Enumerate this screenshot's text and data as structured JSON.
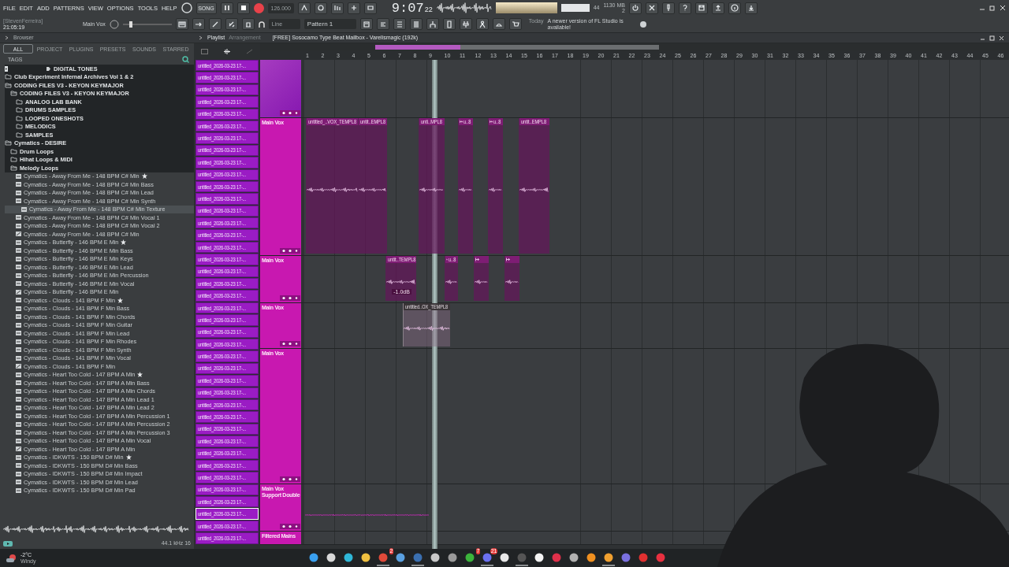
{
  "menu": [
    "FILE",
    "EDIT",
    "ADD",
    "PATTERNS",
    "VIEW",
    "OPTIONS",
    "TOOLS",
    "HELP"
  ],
  "hint": "[StevenFerreira]",
  "clock": "21:05:19",
  "channel": "Main Vox",
  "transport": {
    "mode": "SONG",
    "record_armed": true,
    "tempo": "126.000"
  },
  "song_time": {
    "main": "9:07",
    "sub": "22"
  },
  "meters": {
    "cpu": "44",
    "memory": "1130 MB",
    "polyphony": "2"
  },
  "snap": "Line",
  "pattern": "Pattern 1",
  "news": {
    "date": "Today",
    "text": "A newer version of FL Studio is available!"
  },
  "browser": {
    "title": "Browser",
    "tabs": [
      {
        "label": "ALL",
        "selected": true
      },
      {
        "label": "PROJECT",
        "selected": false
      },
      {
        "label": "PLUGINS",
        "selected": false
      },
      {
        "label": "PRESETS",
        "selected": false
      },
      {
        "label": "SOUNDS",
        "selected": false
      },
      {
        "label": "STARRED",
        "selected": false
      }
    ],
    "tags_label": "TAGS",
    "tree": [
      {
        "kind": "tag",
        "label": "DIGITAL TONES"
      },
      {
        "kind": "folder",
        "label": "Club Experiment Infernal Archives Vol 1 & 2",
        "expanded": false
      },
      {
        "kind": "folder",
        "label": "CODING FILES V3 - KEYON KEYMAJOR",
        "expanded": true,
        "children": [
          {
            "kind": "folder",
            "label": "CODING FILES V3 - KEYON KEYMAJOR",
            "expanded": true,
            "children": [
              {
                "kind": "folder",
                "label": "ANALOG LAB BANK",
                "expanded": false
              },
              {
                "kind": "folder",
                "label": "DRUMS SAMPLES",
                "expanded": false
              },
              {
                "kind": "folder",
                "label": "LOOPED ONESHOTS",
                "expanded": false
              },
              {
                "kind": "folder",
                "label": "MELODICS",
                "expanded": false
              },
              {
                "kind": "folder",
                "label": "SAMPLES",
                "expanded": false
              }
            ]
          }
        ]
      },
      {
        "kind": "folder",
        "label": "Cymatics - DESIRE",
        "expanded": true,
        "children": [
          {
            "kind": "folder",
            "label": "Drum Loops",
            "expanded": false
          },
          {
            "kind": "folder",
            "label": "Hihat Loops & MIDI",
            "expanded": false
          },
          {
            "kind": "folder",
            "label": "Melody Loops",
            "expanded": true,
            "children": [
              {
                "kind": "audio",
                "label": "Cymatics - Away From Me - 148 BPM C# Min",
                "starred": true,
                "selected": false
              },
              {
                "kind": "audio",
                "label": "Cymatics - Away From Me - 148 BPM C# Min Bass",
                "starred": false,
                "selected": false
              },
              {
                "kind": "audio",
                "label": "Cymatics - Away From Me - 148 BPM C# Min Lead",
                "starred": false,
                "selected": false
              },
              {
                "kind": "audio",
                "label": "Cymatics - Away From Me - 148 BPM C# Min Synth",
                "starred": false,
                "selected": false
              },
              {
                "kind": "audio",
                "label": "Cymatics - Away From Me - 148 BPM C# Min Texture",
                "starred": false,
                "selected": true
              },
              {
                "kind": "audio",
                "label": "Cymatics - Away From Me - 148 BPM C# Min Vocal 1",
                "starred": false,
                "selected": false
              },
              {
                "kind": "audio",
                "label": "Cymatics - Away From Me - 148 BPM C# Min Vocal 2",
                "starred": false,
                "selected": false
              },
              {
                "kind": "midi",
                "label": "Cymatics - Away From Me - 148 BPM C# Min",
                "starred": false,
                "selected": false
              },
              {
                "kind": "audio",
                "label": "Cymatics - Butterfly - 146 BPM E Min",
                "starred": true,
                "selected": false
              },
              {
                "kind": "audio",
                "label": "Cymatics - Butterfly - 146 BPM E Min Bass",
                "starred": false,
                "selected": false
              },
              {
                "kind": "audio",
                "label": "Cymatics - Butterfly - 146 BPM E Min Keys",
                "starred": false,
                "selected": false
              },
              {
                "kind": "audio",
                "label": "Cymatics - Butterfly - 146 BPM E Min Lead",
                "starred": false,
                "selected": false
              },
              {
                "kind": "audio",
                "label": "Cymatics - Butterfly - 146 BPM E Min Percussion",
                "starred": false,
                "selected": false
              },
              {
                "kind": "audio",
                "label": "Cymatics - Butterfly - 146 BPM E Min Vocal",
                "starred": false,
                "selected": false
              },
              {
                "kind": "midi",
                "label": "Cymatics - Butterfly - 146 BPM E Min",
                "starred": false,
                "selected": false
              },
              {
                "kind": "audio",
                "label": "Cymatics - Clouds - 141 BPM F Min",
                "starred": true,
                "selected": false
              },
              {
                "kind": "audio",
                "label": "Cymatics - Clouds - 141 BPM F Min Bass",
                "starred": false,
                "selected": false
              },
              {
                "kind": "audio",
                "label": "Cymatics - Clouds - 141 BPM F Min Chords",
                "starred": false,
                "selected": false
              },
              {
                "kind": "audio",
                "label": "Cymatics - Clouds - 141 BPM F Min Guitar",
                "starred": false,
                "selected": false
              },
              {
                "kind": "audio",
                "label": "Cymatics - Clouds - 141 BPM F Min Lead",
                "starred": false,
                "selected": false
              },
              {
                "kind": "audio",
                "label": "Cymatics - Clouds - 141 BPM F Min Rhodes",
                "starred": false,
                "selected": false
              },
              {
                "kind": "audio",
                "label": "Cymatics - Clouds - 141 BPM F Min Synth",
                "starred": false,
                "selected": false
              },
              {
                "kind": "audio",
                "label": "Cymatics - Clouds - 141 BPM F Min Vocal",
                "starred": false,
                "selected": false
              },
              {
                "kind": "midi",
                "label": "Cymatics - Clouds - 141 BPM F Min",
                "starred": false,
                "selected": false
              },
              {
                "kind": "audio",
                "label": "Cymatics - Heart Too Cold - 147 BPM A Min",
                "starred": true,
                "selected": false
              },
              {
                "kind": "audio",
                "label": "Cymatics - Heart Too Cold - 147 BPM A Min Bass",
                "starred": false,
                "selected": false
              },
              {
                "kind": "audio",
                "label": "Cymatics - Heart Too Cold - 147 BPM A Min Chords",
                "starred": false,
                "selected": false
              },
              {
                "kind": "audio",
                "label": "Cymatics - Heart Too Cold - 147 BPM A Min Lead 1",
                "starred": false,
                "selected": false
              },
              {
                "kind": "audio",
                "label": "Cymatics - Heart Too Cold - 147 BPM A Min Lead 2",
                "starred": false,
                "selected": false
              },
              {
                "kind": "audio",
                "label": "Cymatics - Heart Too Cold - 147 BPM A Min Percussion 1",
                "starred": false,
                "selected": false
              },
              {
                "kind": "audio",
                "label": "Cymatics - Heart Too Cold - 147 BPM A Min Percussion 2",
                "starred": false,
                "selected": false
              },
              {
                "kind": "audio",
                "label": "Cymatics - Heart Too Cold - 147 BPM A Min Percussion 3",
                "starred": false,
                "selected": false
              },
              {
                "kind": "audio",
                "label": "Cymatics - Heart Too Cold - 147 BPM A Min Vocal",
                "starred": false,
                "selected": false
              },
              {
                "kind": "midi",
                "label": "Cymatics - Heart Too Cold - 147 BPM A Min",
                "starred": false,
                "selected": false
              },
              {
                "kind": "audio",
                "label": "Cymatics - IDKWTS - 150 BPM D# Min",
                "starred": true,
                "selected": false
              },
              {
                "kind": "audio",
                "label": "Cymatics - IDKWTS - 150 BPM D# Min Bass",
                "starred": false,
                "selected": false
              },
              {
                "kind": "audio",
                "label": "Cymatics - IDKWTS - 150 BPM D# Min Impact",
                "starred": false,
                "selected": false
              },
              {
                "kind": "audio",
                "label": "Cymatics - IDKWTS - 150 BPM D# Min Lead",
                "starred": false,
                "selected": false
              },
              {
                "kind": "audio",
                "label": "Cymatics - IDKWTS - 150 BPM D# Min Pad",
                "starred": false,
                "selected": false
              }
            ]
          }
        ]
      }
    ],
    "sample_info": "44.1 kHz 16"
  },
  "picker": [
    {
      "label": "untitled_2026-03-23 17-...",
      "selected": false
    },
    {
      "label": "untitled_2026-03-23 17-...",
      "selected": false
    },
    {
      "label": "untitled_2026-03-23 17-...",
      "selected": false
    },
    {
      "label": "untitled_2026-03-23 17-...",
      "selected": false
    },
    {
      "label": "untitled_2026-03-23 17-...",
      "selected": false
    },
    {
      "label": "untitled_2026-03-23 17-...",
      "selected": false
    },
    {
      "label": "untitled_2026-03-23 17-...",
      "selected": false
    },
    {
      "label": "untitled_2026-03-23 17-...",
      "selected": false
    },
    {
      "label": "untitled_2026-03-23 17-...",
      "selected": false
    },
    {
      "label": "untitled_2026-03-23 17-...",
      "selected": false
    },
    {
      "label": "untitled_2026-03-23 17-...",
      "selected": false
    },
    {
      "label": "untitled_2026-03-23 17-...",
      "selected": false
    },
    {
      "label": "untitled_2026-03-23 17-...",
      "selected": false
    },
    {
      "label": "untitled_2026-03-23 17-...",
      "selected": false
    },
    {
      "label": "untitled_2026-03-23 17-...",
      "selected": false
    },
    {
      "label": "untitled_2026-03-23 17-...",
      "selected": false
    },
    {
      "label": "untitled_2026-03-23 17-...",
      "selected": false
    },
    {
      "label": "untitled_2026-03-23 17-...",
      "selected": false
    },
    {
      "label": "untitled_2026-03-23 17-...",
      "selected": false
    },
    {
      "label": "untitled_2026-03-23 17-...",
      "selected": false
    },
    {
      "label": "untitled_2026-03-23 17-...",
      "selected": false
    },
    {
      "label": "untitled_2026-03-23 17-...",
      "selected": false
    },
    {
      "label": "untitled_2026-03-23 17-...",
      "selected": false
    },
    {
      "label": "untitled_2026-03-23 17-...",
      "selected": false
    },
    {
      "label": "untitled_2026-03-23 17-...",
      "selected": false
    },
    {
      "label": "untitled_2026-03-23 17-...",
      "selected": false
    },
    {
      "label": "untitled_2026-03-23 17-...",
      "selected": false
    },
    {
      "label": "untitled_2026-03-23 17-...",
      "selected": false
    },
    {
      "label": "untitled_2026-03-23 17-...",
      "selected": false
    },
    {
      "label": "untitled_2026-03-23 17-...",
      "selected": false
    },
    {
      "label": "untitled_2026-03-23 17-...",
      "selected": false
    },
    {
      "label": "untitled_2026-03-23 17-...",
      "selected": false
    },
    {
      "label": "untitled_2026-03-23 17-...",
      "selected": false
    },
    {
      "label": "untitled_2026-03-23 17-...",
      "selected": false
    },
    {
      "label": "untitled_2026-03-23 17-...",
      "selected": false
    },
    {
      "label": "untitled_2026-03-23 17-...",
      "selected": false
    },
    {
      "label": "untitled_2026-03-23 17-...",
      "selected": false
    },
    {
      "label": "untitled_2026-03-23 17-...",
      "selected": true
    },
    {
      "label": "untitled_2026-03-23 17-...",
      "selected": false
    },
    {
      "label": "untitled_2026-03-23 17-...",
      "selected": false
    }
  ],
  "playlist": {
    "title": "Playlist",
    "view": "Arrangement",
    "project": "[FREE] Sosocamo Type Beat Mailbox - Varelismagic (192k)",
    "bars": [
      "1",
      "2",
      "3",
      "4",
      "5",
      "6",
      "7",
      "8",
      "9",
      "10",
      "11",
      "12",
      "13",
      "14",
      "15",
      "16",
      "17",
      "18",
      "19",
      "20",
      "21",
      "22",
      "23",
      "24",
      "25",
      "26",
      "27",
      "28",
      "29",
      "30",
      "31",
      "32",
      "33",
      "34",
      "35",
      "36",
      "37",
      "38",
      "39",
      "40",
      "41",
      "42",
      "43",
      "44",
      "45",
      "46"
    ],
    "tracks": [
      {
        "highlighted": true
      },
      {
        "name": "Main Vox",
        "highlighted": false,
        "clips": [
          {
            "kind": "block",
            "label": "untitled_..VOX_TEMPL8",
            "muted": false
          },
          {
            "kind": "block",
            "label": "untit..EMPL8",
            "muted": false
          },
          {
            "kind": "block",
            "label": "unti..MPL8",
            "muted": false
          },
          {
            "kind": "block",
            "label": "u..8",
            "muted": false
          },
          {
            "kind": "block",
            "label": "u..8",
            "muted": false
          },
          {
            "kind": "block",
            "label": "untit..EMPL8",
            "muted": false
          }
        ]
      },
      {
        "name": "Main Vox",
        "highlighted": false,
        "clips": [
          {
            "kind": "block",
            "label": "untit..TEMPL8",
            "tip": "-1.0dB",
            "muted": false
          },
          {
            "kind": "block",
            "label": "u..8",
            "muted": false
          },
          {
            "kind": "block",
            "muted": false
          },
          {
            "kind": "block",
            "muted": false
          }
        ]
      },
      {
        "name": "Main Vox",
        "highlighted": false,
        "clips": [
          {
            "kind": "block",
            "label": "untitled..OX_TEMPL8",
            "muted": true
          }
        ]
      },
      {
        "name": "Main Vox",
        "highlighted": false
      },
      {
        "name": "Main Vox Support Double",
        "highlighted": false,
        "clips": [
          {
            "kind": "line"
          }
        ]
      },
      {
        "name": "Filtered Mains",
        "highlighted": false
      }
    ]
  },
  "taskbar": {
    "weather": {
      "temp": "-2°C",
      "condition": "Windy"
    },
    "apps": [
      {
        "color": "#3aa0f0",
        "running": false
      },
      {
        "color": "#d8d8d8",
        "running": false
      },
      {
        "color": "#2fb7d8",
        "running": false
      },
      {
        "color": "#f0c040",
        "running": false
      },
      {
        "color": "#e04a3a",
        "running": true,
        "badge": "2"
      },
      {
        "color": "#5aa0e0",
        "running": false
      },
      {
        "color": "#3a6fb0",
        "running": true
      },
      {
        "color": "#c8c8c8",
        "running": false
      },
      {
        "color": "#9a9a9a",
        "running": false
      },
      {
        "color": "#3cb43c",
        "running": false,
        "badge": "7"
      },
      {
        "color": "#6a70f0",
        "running": true,
        "badge": "21"
      },
      {
        "color": "#e8e8e8",
        "running": false
      },
      {
        "color": "#555555",
        "running": true
      },
      {
        "color": "#f4f4f4",
        "running": false
      },
      {
        "color": "#e0304a",
        "running": false
      },
      {
        "color": "#b0b0b0",
        "running": false
      },
      {
        "color": "#f09020",
        "running": false
      },
      {
        "color": "#f0a030",
        "running": true
      },
      {
        "color": "#7a70e0",
        "running": false
      },
      {
        "color": "#e03030",
        "running": false
      },
      {
        "color": "#e83040",
        "running": false
      }
    ]
  }
}
